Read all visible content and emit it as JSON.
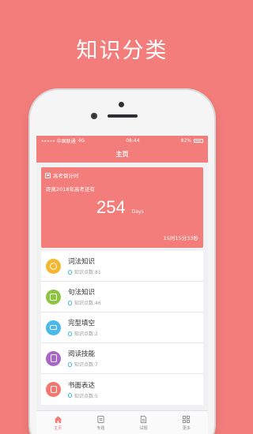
{
  "promo": {
    "title": "知识分类"
  },
  "statusbar": {
    "carrier": "••••• 中国联通",
    "network": "4G",
    "time": "08:44",
    "battery": "82%"
  },
  "navbar": {
    "title": "主页"
  },
  "countdown": {
    "label": "高考倒计时",
    "subtitle": "距离2018年高考还有",
    "days": "254",
    "unit": "Days",
    "remaining": "15时15分33秒"
  },
  "categories": [
    {
      "title": "词法知识",
      "points": "知识点数:81",
      "color": "#f5b731"
    },
    {
      "title": "句法知识",
      "points": "知识点数:46",
      "color": "#8cc63f"
    },
    {
      "title": "完型填空",
      "points": "知识点数:2",
      "color": "#4ab8e8"
    },
    {
      "title": "阅读技能",
      "points": "知识点数:7",
      "color": "#a966c8"
    },
    {
      "title": "书面表达",
      "points": "知识点数:5",
      "color": "#f2776f"
    }
  ],
  "tabs": [
    {
      "label": "主页",
      "icon": "home-icon",
      "active": true
    },
    {
      "label": "专题",
      "icon": "topic-icon",
      "active": false
    },
    {
      "label": "试题",
      "icon": "exam-icon",
      "active": false
    },
    {
      "label": "更多",
      "icon": "more-icon",
      "active": false
    }
  ],
  "colors": {
    "brand": "#f27d7b",
    "bulb": "#45b9d6"
  }
}
